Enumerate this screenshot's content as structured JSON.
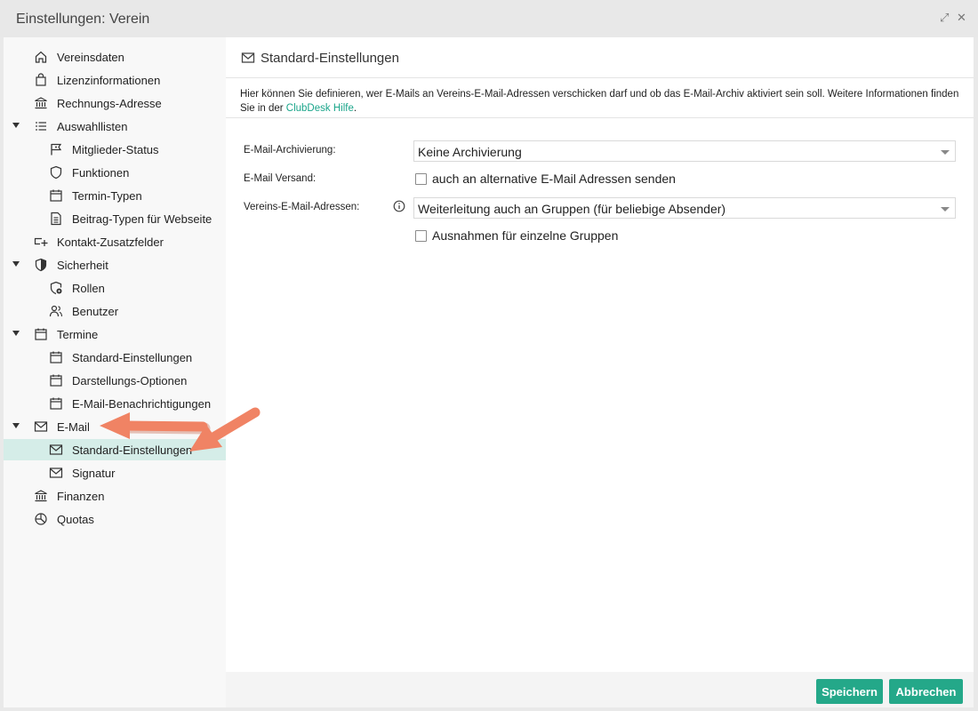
{
  "window": {
    "title": "Einstellungen: Verein",
    "expand_icon": "expand-icon",
    "close_icon": "close-icon",
    "expand_glyph": "⤢",
    "close_glyph": "✕"
  },
  "sidebar": {
    "items": [
      {
        "id": "vereinsdaten",
        "label": "Vereinsdaten",
        "icon": "home-icon",
        "level": 0
      },
      {
        "id": "lizenzinformationen",
        "label": "Lizenzinformationen",
        "icon": "shopping-bag-icon",
        "level": 0
      },
      {
        "id": "rechnungs-adresse",
        "label": "Rechnungs-Adresse",
        "icon": "bank-icon",
        "level": 0
      },
      {
        "id": "auswahllisten",
        "label": "Auswahllisten",
        "icon": "list-icon",
        "level": 0,
        "expanded": true
      },
      {
        "id": "mitglieder-status",
        "label": "Mitglieder-Status",
        "icon": "flag-icon",
        "level": 1
      },
      {
        "id": "funktionen",
        "label": "Funktionen",
        "icon": "shield-icon",
        "level": 1
      },
      {
        "id": "termin-typen",
        "label": "Termin-Typen",
        "icon": "calendar-icon",
        "level": 1
      },
      {
        "id": "beitrag-typen",
        "label": "Beitrag-Typen für Webseite",
        "icon": "document-icon",
        "level": 1
      },
      {
        "id": "kontakt-zusatzfelder",
        "label": "Kontakt-Zusatzfelder",
        "icon": "field-add-icon",
        "level": 0
      },
      {
        "id": "sicherheit",
        "label": "Sicherheit",
        "icon": "shield-half-icon",
        "level": 0,
        "expanded": true
      },
      {
        "id": "rollen",
        "label": "Rollen",
        "icon": "shield-gear-icon",
        "level": 1
      },
      {
        "id": "benutzer",
        "label": "Benutzer",
        "icon": "users-icon",
        "level": 1
      },
      {
        "id": "termine",
        "label": "Termine",
        "icon": "calendar-icon",
        "level": 0,
        "expanded": true
      },
      {
        "id": "termine-standard",
        "label": "Standard-Einstellungen",
        "icon": "calendar-icon",
        "level": 1
      },
      {
        "id": "darstellungs-optionen",
        "label": "Darstellungs-Optionen",
        "icon": "calendar-icon",
        "level": 1
      },
      {
        "id": "email-benachrichtigungen",
        "label": "E-Mail-Benachrichtigungen",
        "icon": "calendar-icon",
        "level": 1
      },
      {
        "id": "email",
        "label": "E-Mail",
        "icon": "mail-icon",
        "level": 0,
        "expanded": true
      },
      {
        "id": "email-standard",
        "label": "Standard-Einstellungen",
        "icon": "mail-icon",
        "level": 1,
        "selected": true
      },
      {
        "id": "signatur",
        "label": "Signatur",
        "icon": "mail-icon",
        "level": 1
      },
      {
        "id": "finanzen",
        "label": "Finanzen",
        "icon": "bank-icon",
        "level": 0
      },
      {
        "id": "quotas",
        "label": "Quotas",
        "icon": "pie-chart-icon",
        "level": 0
      }
    ]
  },
  "panel": {
    "title": "Standard-Einstellungen",
    "icon": "mail-icon",
    "description_prefix": "Hier können Sie definieren, wer E-Mails an Vereins-E-Mail-Adressen verschicken darf und ob das E-Mail-Archiv aktiviert sein soll. Weitere Informationen finden Sie in der ",
    "description_link": "ClubDesk Hilfe",
    "description_suffix": "."
  },
  "form": {
    "archiving": {
      "label": "E-Mail-Archivierung:",
      "value": "Keine Archivierung"
    },
    "sending": {
      "label": "E-Mail Versand:",
      "checkbox_label": "auch an alternative E-Mail Adressen senden",
      "checked": false
    },
    "addresses": {
      "label": "Vereins-E-Mail-Adressen:",
      "info_icon": "info-icon",
      "value": "Weiterleitung auch an Gruppen (für beliebige Absender)"
    },
    "exceptions": {
      "checkbox_label": "Ausnahmen für einzelne Gruppen",
      "checked": false
    }
  },
  "footer": {
    "save_label": "Speichern",
    "cancel_label": "Abbrechen"
  },
  "colors": {
    "accent": "#24a889",
    "link": "#1aa58a",
    "selected_bg": "#d5ede8",
    "annotation_arrow": "#f08364"
  }
}
